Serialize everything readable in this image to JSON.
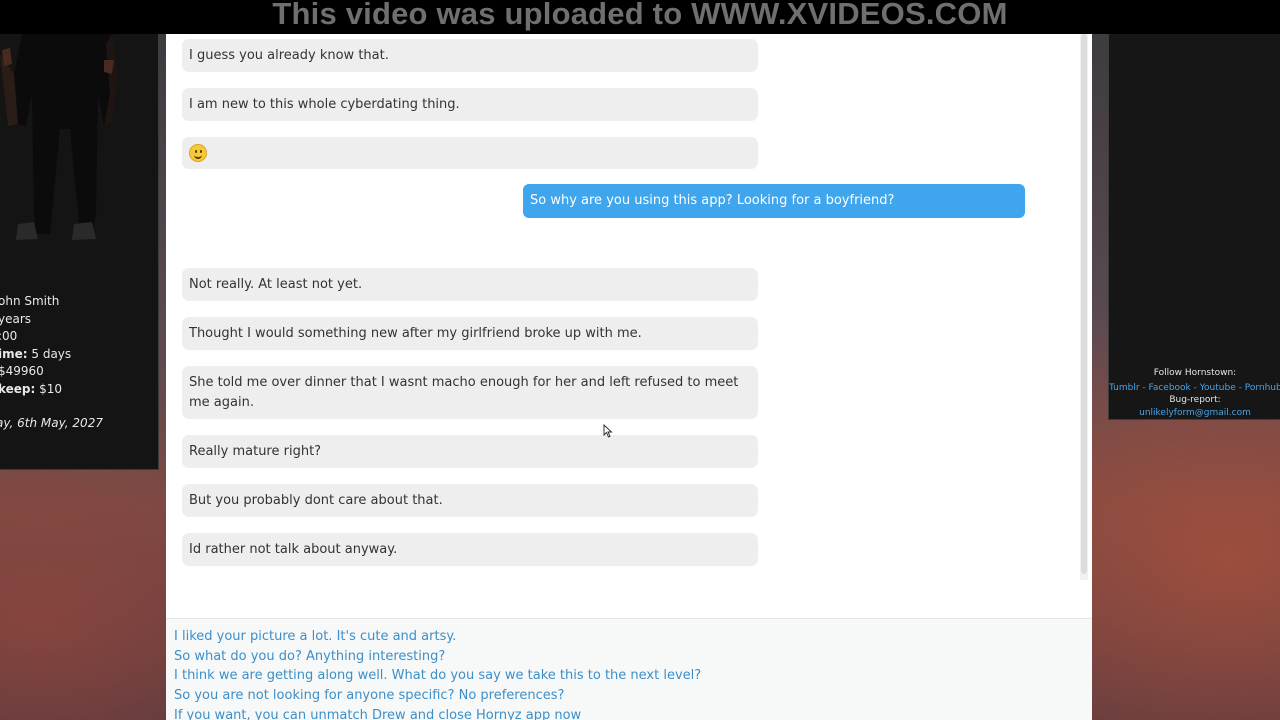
{
  "watermark": "This video was uploaded to WWW.XVIDEOS.COM",
  "profile": {
    "name_text": "ohn Smith",
    "age_text": "years",
    "value3_text": ":00",
    "time_label": "ime:",
    "time_value": "5 days",
    "money_text": "$49960",
    "upkeep_label": "keep:",
    "upkeep_value": "$10",
    "date_text": "ay, 6th May, 2027"
  },
  "sidebar_right": {
    "follow_label": "Follow Hornstown:",
    "links_text": "Tumblr - Facebook - Youtube - Pornhub -",
    "bug_label": "Bug-report:",
    "email": "unlikelyform@gmail.com"
  },
  "messages": [
    {
      "side": "received",
      "text": "I guess you already know that."
    },
    {
      "side": "received",
      "text": "I am new to this whole cyberdating thing."
    },
    {
      "side": "received",
      "emoji": "smiley-emoji",
      "text": ""
    },
    {
      "side": "sent",
      "text": "So why are you using this app? Looking for a boyfriend?"
    },
    {
      "side": "received",
      "text": "Not really. At least not yet."
    },
    {
      "side": "received",
      "text": "Thought I would something new after my girlfriend broke up with me."
    },
    {
      "side": "received",
      "text": "She told me over dinner that I wasnt macho enough for her and left refused to meet me again."
    },
    {
      "side": "received",
      "text": "Really mature right?"
    },
    {
      "side": "received",
      "text": "But you probably dont care about that."
    },
    {
      "side": "received",
      "text": "Id rather not talk about anyway."
    }
  ],
  "reply_options": [
    "I liked your picture a lot. It's cute and artsy.",
    "So what do you do? Anything interesting?",
    "I think we are getting along well. What do you say we take this to the next level?",
    "So you are not looking for anyone specific? No preferences?",
    "If you want, you can unmatch Drew and close Hornyz app now"
  ]
}
